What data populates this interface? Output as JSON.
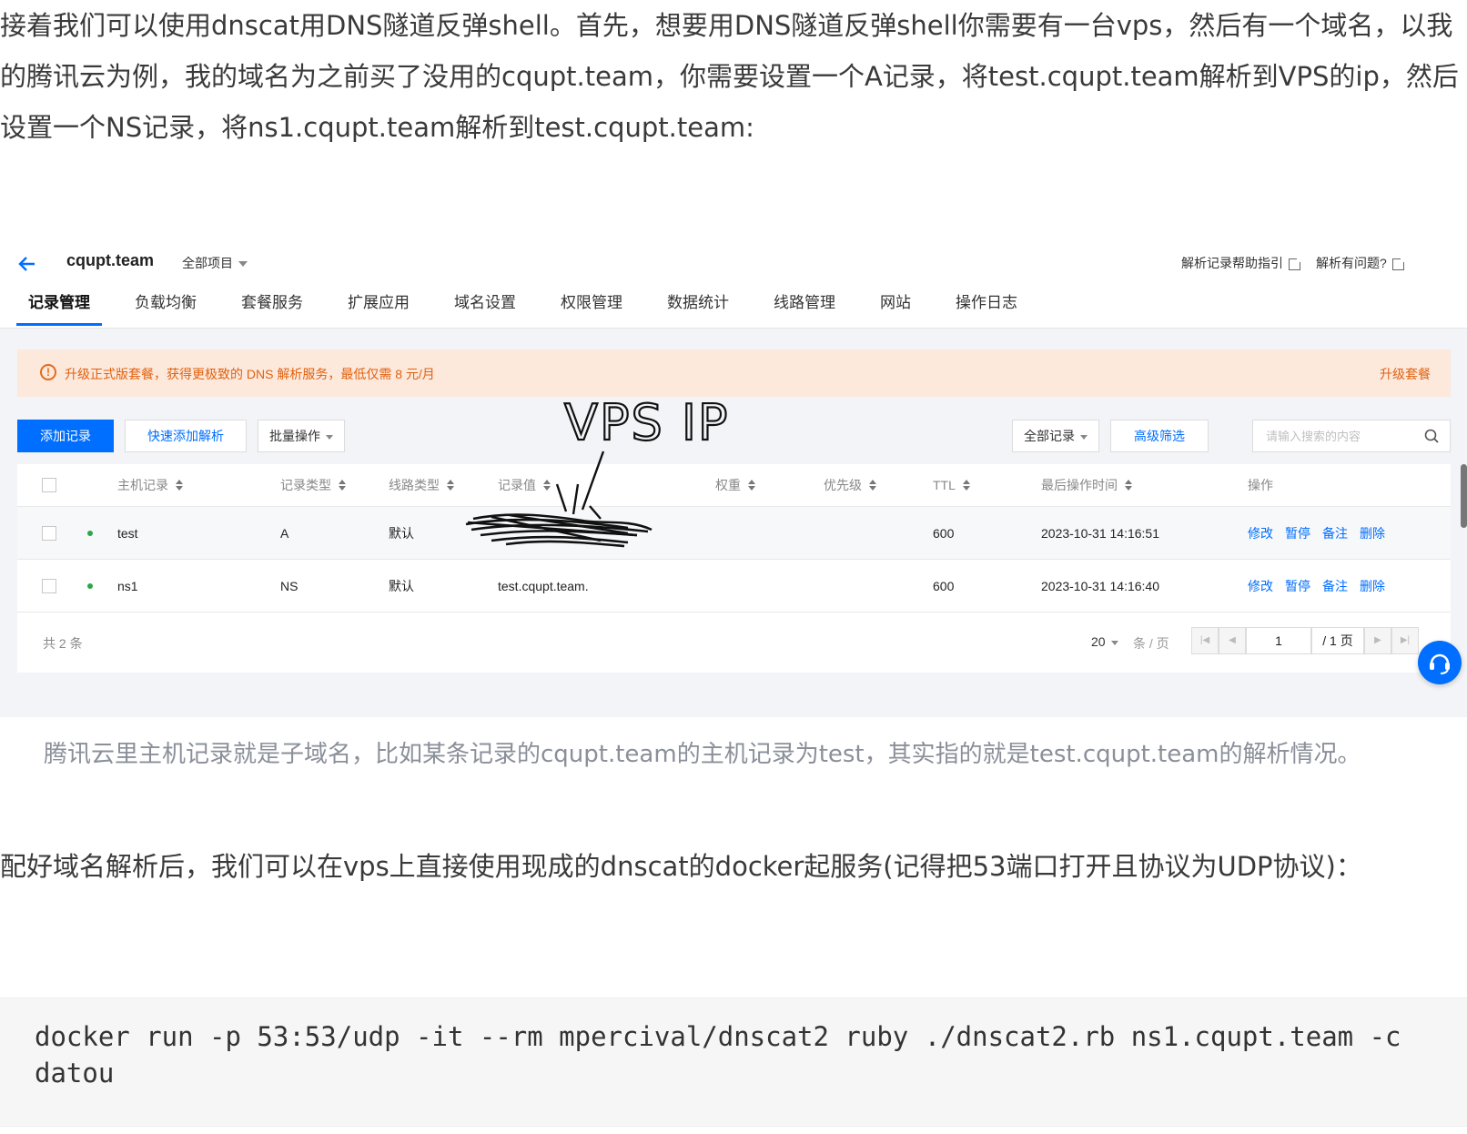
{
  "article": {
    "intro_paragraph": "接着我们可以使用dnscat用DNS隧道反弹shell。首先，想要用DNS隧道反弹shell你需要有一台vps，然后有一个域名，以我的腾讯云为例，我的域名为之前买了没用的cqupt.team，你需要设置一个A记录，将test.cqupt.team解析到VPS的ip，然后设置一个NS记录，将ns1.cqupt.team解析到test.cqupt.team:",
    "caption": "腾讯云里主机记录就是子域名，比如某条记录的cqupt.team的主机记录为test，其实指的就是test.cqupt.team的解析情况。",
    "second_paragraph": "配好域名解析后，我们可以在vps上直接使用现成的dnscat的docker起服务(记得把53端口打开且协议为UDP协议)：",
    "code": "docker run -p 53:53/udp -it --rm mpercival/dnscat2 ruby ./dnscat2.rb ns1.cqupt.team -c datou"
  },
  "screenshot": {
    "header": {
      "domain": "cqupt.team",
      "project_select": "全部项目",
      "help_link_1": "解析记录帮助指引",
      "help_link_2": "解析有问题?"
    },
    "tabs": [
      {
        "label": "记录管理",
        "active": true
      },
      {
        "label": "负载均衡"
      },
      {
        "label": "套餐服务"
      },
      {
        "label": "扩展应用"
      },
      {
        "label": "域名设置"
      },
      {
        "label": "权限管理"
      },
      {
        "label": "数据统计"
      },
      {
        "label": "线路管理"
      },
      {
        "label": "网站"
      },
      {
        "label": "操作日志"
      }
    ],
    "notice": {
      "text": "升级正式版套餐，获得更极致的 DNS 解析服务，最低仅需 8 元/月",
      "action": "升级套餐"
    },
    "toolbar": {
      "add_record": "添加记录",
      "quick_add": "快速添加解析",
      "batch": "批量操作",
      "record_filter": "全部记录",
      "advanced_filter": "高级筛选",
      "search_placeholder": "请输入搜索的内容"
    },
    "annotation": "VPS IP",
    "table": {
      "columns": [
        "主机记录",
        "记录类型",
        "线路类型",
        "记录值",
        "权重",
        "优先级",
        "TTL",
        "最后操作时间",
        "操作"
      ],
      "rows": [
        {
          "host": "test",
          "type": "A",
          "line": "默认",
          "value": "",
          "weight": "",
          "priority": "",
          "ttl": "600",
          "time": "2023-10-31 14:16:51"
        },
        {
          "host": "ns1",
          "type": "NS",
          "line": "默认",
          "value": "test.cqupt.team.",
          "weight": "",
          "priority": "",
          "ttl": "600",
          "time": "2023-10-31 14:16:40"
        }
      ],
      "actions": [
        "修改",
        "暂停",
        "备注",
        "删除"
      ]
    },
    "pager": {
      "total": "共 2 条",
      "page_size": "20",
      "unit": "条 / 页",
      "current_page": "1",
      "total_pages": "/ 1 页"
    }
  },
  "colors": {
    "brand_blue": "#006eff",
    "warning_orange": "#e0620f",
    "notice_bg": "#fde8dc",
    "status_green": "#2aa845"
  }
}
